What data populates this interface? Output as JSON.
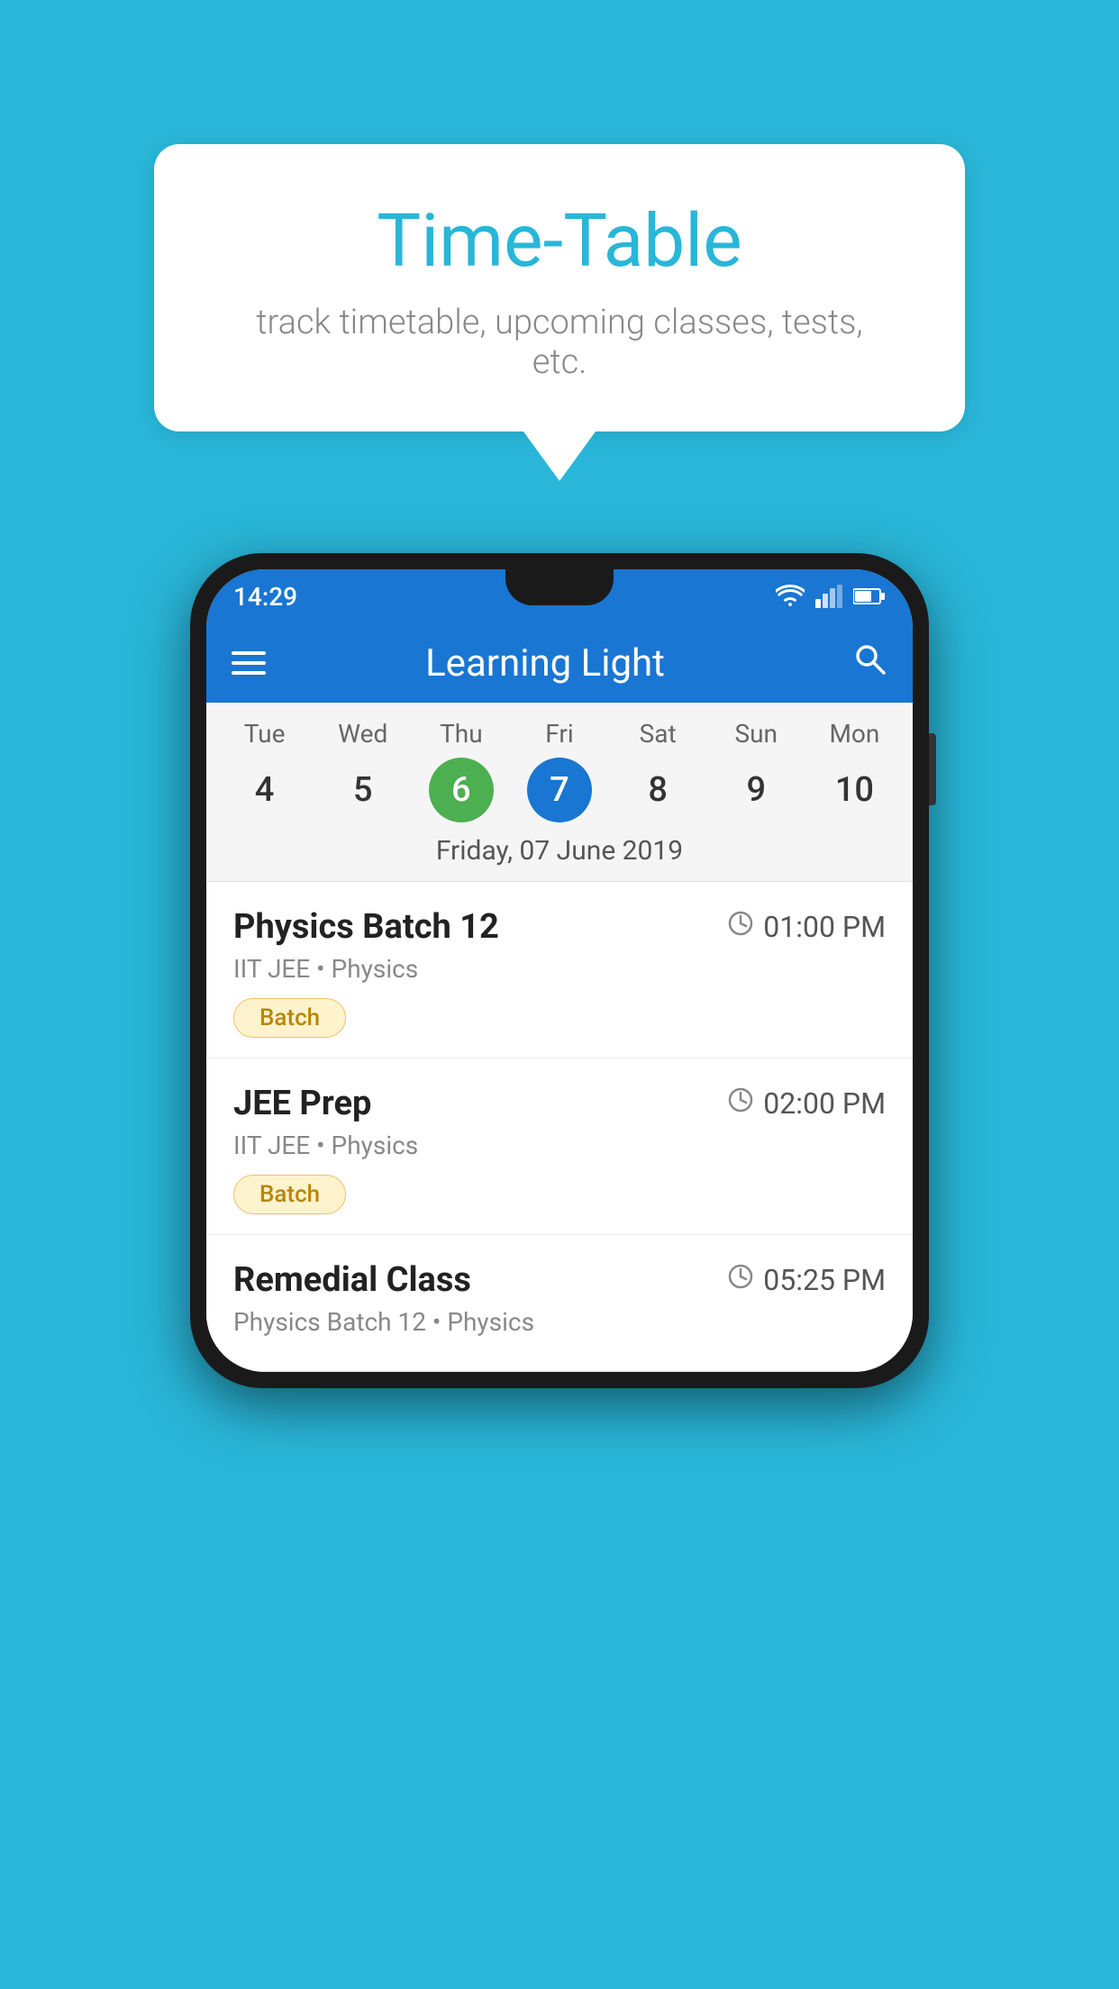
{
  "background_color": "#29b6d8",
  "speech_bubble": {
    "title": "Time-Table",
    "subtitle": "track timetable, upcoming classes, tests, etc."
  },
  "phone": {
    "status_bar": {
      "time": "14:29"
    },
    "app_bar": {
      "title": "Learning Light"
    },
    "calendar": {
      "days": [
        {
          "name": "Tue",
          "num": "4",
          "state": "normal"
        },
        {
          "name": "Wed",
          "num": "5",
          "state": "normal"
        },
        {
          "name": "Thu",
          "num": "6",
          "state": "today"
        },
        {
          "name": "Fri",
          "num": "7",
          "state": "selected"
        },
        {
          "name": "Sat",
          "num": "8",
          "state": "normal"
        },
        {
          "name": "Sun",
          "num": "9",
          "state": "normal"
        },
        {
          "name": "Mon",
          "num": "10",
          "state": "normal"
        }
      ],
      "selected_date_label": "Friday, 07 June 2019"
    },
    "schedule": [
      {
        "title": "Physics Batch 12",
        "time": "01:00 PM",
        "subtitle": "IIT JEE • Physics",
        "badge": "Batch"
      },
      {
        "title": "JEE Prep",
        "time": "02:00 PM",
        "subtitle": "IIT JEE • Physics",
        "badge": "Batch"
      },
      {
        "title": "Remedial Class",
        "time": "05:25 PM",
        "subtitle": "Physics Batch 12 • Physics",
        "badge": null
      }
    ]
  }
}
